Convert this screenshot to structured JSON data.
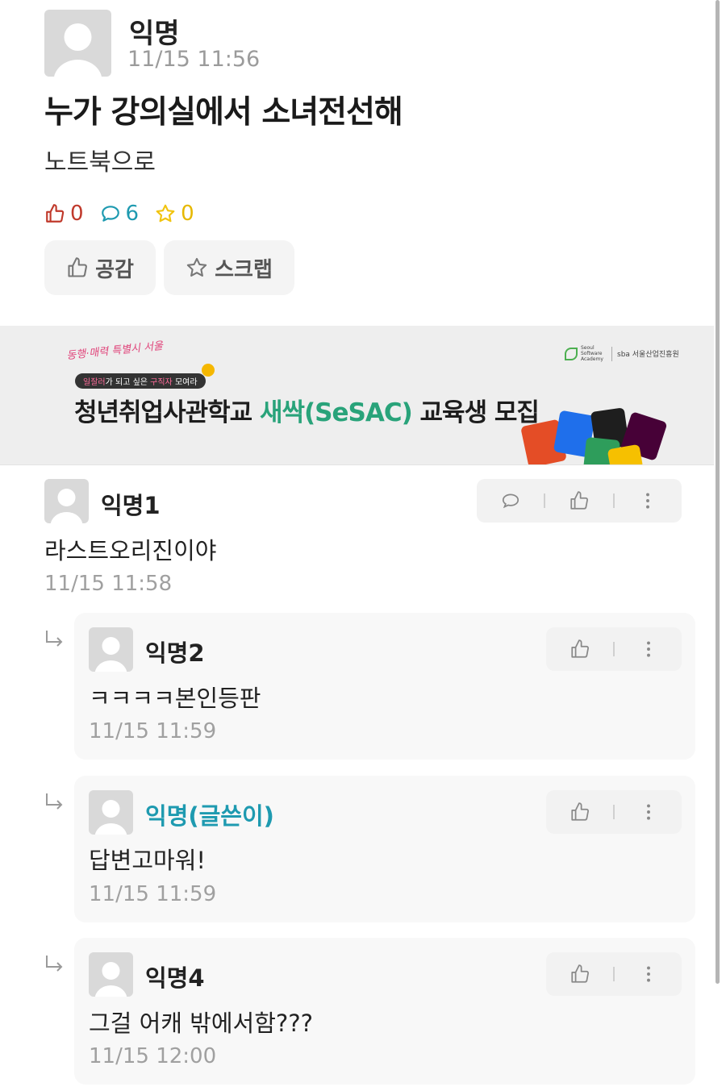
{
  "post": {
    "author": "익명",
    "time": "11/15 11:56",
    "title": "누가 강의실에서 소녀전선해",
    "body": "노트북으로",
    "likes": "0",
    "comments": "6",
    "scraps": "0",
    "like_button": "공감",
    "scrap_button": "스크랩"
  },
  "banner": {
    "logo_text": "동행·매력 특별시 서울",
    "tag_pre": "일잘러",
    "tag_mid": "가 되고 싶은 ",
    "tag_hl": "구직자",
    "tag_post": " 모여라",
    "headline_pre": "청년취업사관학교 ",
    "headline_hl": "새싹(SeSAC)",
    "headline_post": " 교육생 모집",
    "sponsor_small": "Seoul Software Academy",
    "sponsor": "sba 서울산업진흥원"
  },
  "comments": [
    {
      "author": "익명1",
      "text": "라스트오리진이야",
      "time": "11/15 11:58"
    },
    {
      "author": "익명2",
      "text": "ㅋㅋㅋㅋ본인등판",
      "time": "11/15 11:59"
    },
    {
      "author": "익명(글쓴이)",
      "text": "답변고마워!",
      "time": "11/15 11:59"
    },
    {
      "author": "익명4",
      "text": "그걸 어캐 밖에서함???",
      "time": "11/15 12:00"
    }
  ],
  "colors": {
    "like": "#c0392b",
    "comment": "#1e9ab0",
    "scrap": "#f1c40f",
    "op_author": "#1e9ab0"
  }
}
